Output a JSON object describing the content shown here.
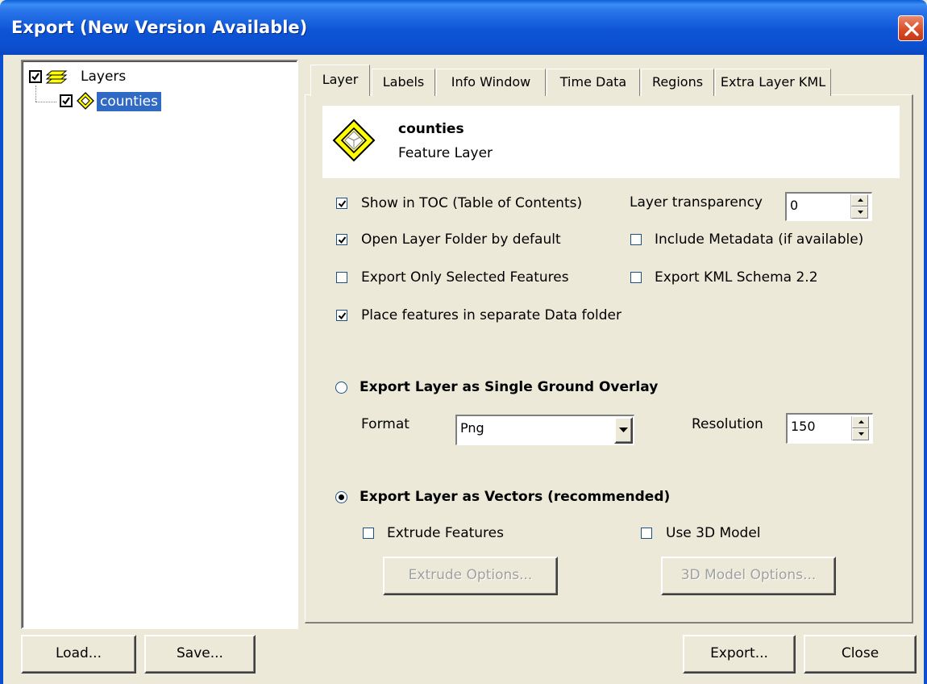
{
  "window": {
    "title": "Export (New Version Available)"
  },
  "tree": {
    "root_label": "Layers",
    "child_label": "counties"
  },
  "tabs": [
    {
      "label": "Layer",
      "active": true
    },
    {
      "label": "Labels"
    },
    {
      "label": "Info Window"
    },
    {
      "label": "Time Data"
    },
    {
      "label": "Regions"
    },
    {
      "label": "Extra Layer KML"
    }
  ],
  "layer_header": {
    "name": "counties",
    "type": "Feature Layer"
  },
  "options": {
    "show_in_toc": {
      "label": "Show in TOC (Table of Contents)",
      "checked": true
    },
    "open_layer_folder": {
      "label": "Open Layer Folder by default",
      "checked": true
    },
    "export_only_selected": {
      "label": "Export Only Selected Features",
      "checked": false
    },
    "place_features_separate": {
      "label": "Place features in separate Data folder",
      "checked": true
    },
    "include_metadata": {
      "label": "Include Metadata (if available)",
      "checked": false
    },
    "export_kml_schema": {
      "label": "Export KML Schema 2.2",
      "checked": false
    },
    "transparency_label": "Layer transparency",
    "transparency_value": "0"
  },
  "ground_overlay": {
    "label": "Export Layer as Single Ground Overlay",
    "selected": false,
    "format_label": "Format",
    "format_value": "Png",
    "resolution_label": "Resolution",
    "resolution_value": "150"
  },
  "vectors": {
    "label": "Export Layer as Vectors (recommended)",
    "selected": true,
    "extrude_label": "Extrude Features",
    "use3d_label": "Use 3D Model",
    "extrude_options_button": "Extrude Options...",
    "model_options_button": "3D Model Options..."
  },
  "footer": {
    "load_button": "Load...",
    "save_button": "Save...",
    "export_button": "Export...",
    "close_button": "Close"
  }
}
